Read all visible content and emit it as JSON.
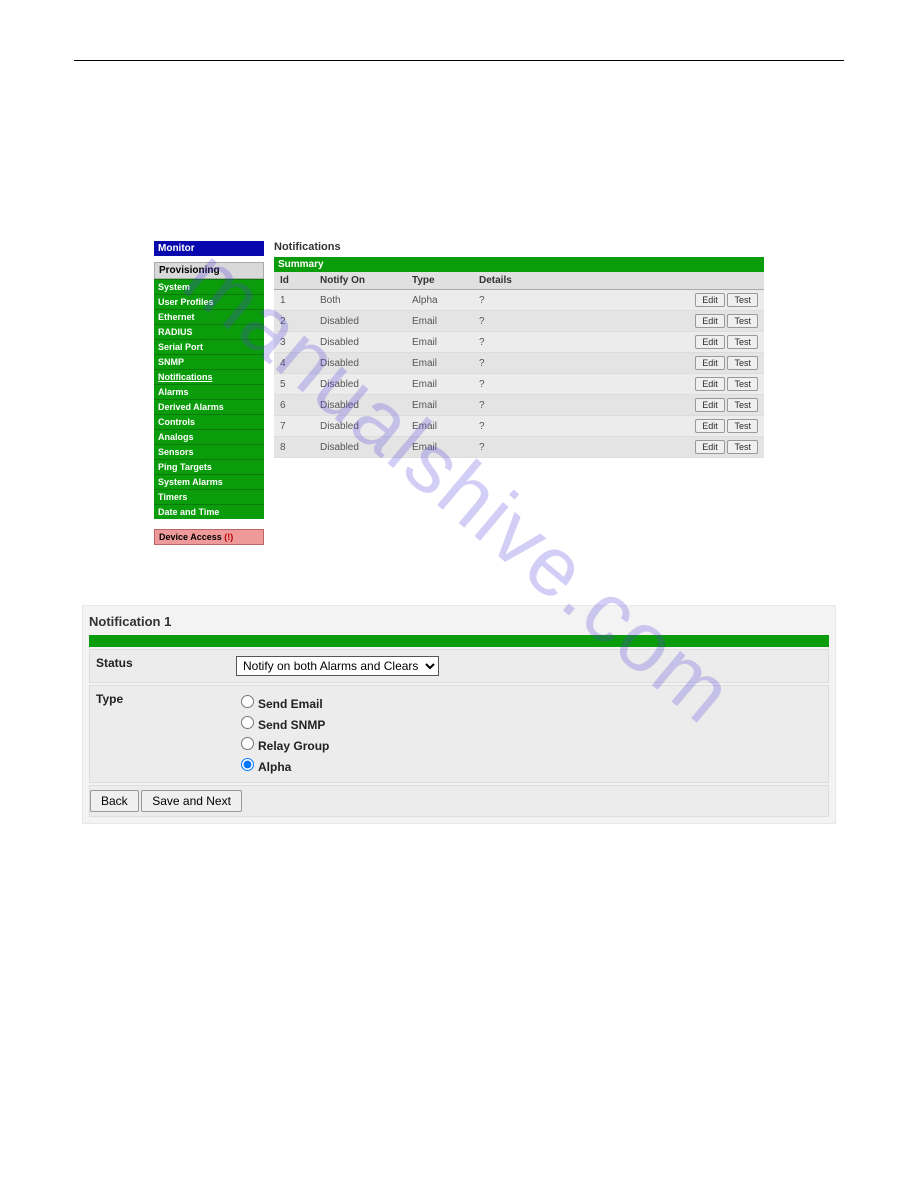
{
  "sidebar": {
    "monitor": "Monitor",
    "provisioning": "Provisioning",
    "items": [
      {
        "label": "System"
      },
      {
        "label": "User Profiles"
      },
      {
        "label": "Ethernet"
      },
      {
        "label": "RADIUS"
      },
      {
        "label": "Serial Port"
      },
      {
        "label": "SNMP"
      },
      {
        "label": "Notifications"
      },
      {
        "label": "Alarms"
      },
      {
        "label": "Derived Alarms"
      },
      {
        "label": "Controls"
      },
      {
        "label": "Analogs"
      },
      {
        "label": "Sensors"
      },
      {
        "label": "Ping Targets"
      },
      {
        "label": "System Alarms"
      },
      {
        "label": "Timers"
      },
      {
        "label": "Date and Time"
      }
    ],
    "device_access": "Device Access",
    "device_access_mark": "(!)"
  },
  "main": {
    "title": "Notifications",
    "summary_label": "Summary",
    "headers": {
      "id": "Id",
      "notify_on": "Notify On",
      "type": "Type",
      "details": "Details"
    },
    "rows": [
      {
        "id": "1",
        "notify_on": "Both",
        "type": "Alpha",
        "details": "?"
      },
      {
        "id": "2",
        "notify_on": "Disabled",
        "type": "Email",
        "details": "?"
      },
      {
        "id": "3",
        "notify_on": "Disabled",
        "type": "Email",
        "details": "?"
      },
      {
        "id": "4",
        "notify_on": "Disabled",
        "type": "Email",
        "details": "?"
      },
      {
        "id": "5",
        "notify_on": "Disabled",
        "type": "Email",
        "details": "?"
      },
      {
        "id": "6",
        "notify_on": "Disabled",
        "type": "Email",
        "details": "?"
      },
      {
        "id": "7",
        "notify_on": "Disabled",
        "type": "Email",
        "details": "?"
      },
      {
        "id": "8",
        "notify_on": "Disabled",
        "type": "Email",
        "details": "?"
      }
    ],
    "edit_label": "Edit",
    "test_label": "Test"
  },
  "detail": {
    "title": "Notification 1",
    "status_label": "Status",
    "status_selected": "Notify on both Alarms and Clears",
    "type_label": "Type",
    "type_options": [
      {
        "label": "Send Email",
        "checked": false
      },
      {
        "label": "Send SNMP",
        "checked": false
      },
      {
        "label": "Relay Group",
        "checked": false
      },
      {
        "label": "Alpha",
        "checked": true
      }
    ],
    "back_label": "Back",
    "save_next_label": "Save and Next"
  },
  "watermark": "manualshive.com"
}
